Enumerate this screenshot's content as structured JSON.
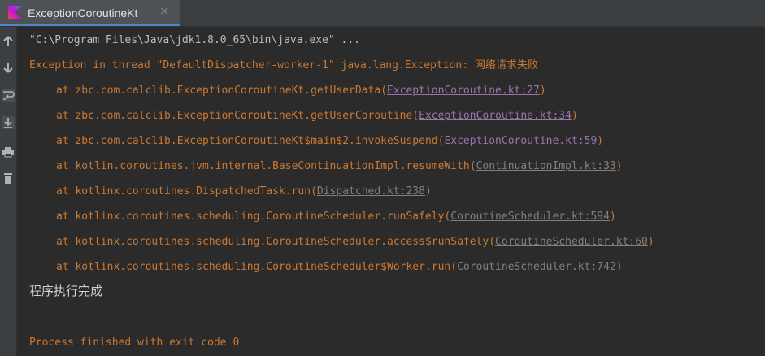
{
  "tab": {
    "title": "ExceptionCoroutineKt",
    "close_glyph": "×",
    "icon": "kotlin-icon"
  },
  "sidebar": {
    "icons": [
      "arrow-up-icon",
      "arrow-down-icon",
      "soft-wrap-icon",
      "scroll-to-end-icon",
      "print-icon",
      "trash-icon"
    ]
  },
  "console": {
    "command": "\"C:\\Program Files\\Java\\jdk1.8.0_65\\bin\\java.exe\" ...",
    "exception_prefix": "Exception in thread \"DefaultDispatcher-worker-1\" java.lang.Exception: ",
    "exception_message": "网络请求失败",
    "trace": [
      {
        "text": "at zbc.com.calclib.ExceptionCoroutineKt.getUserData(",
        "link": "ExceptionCoroutine.kt:27",
        "visited": true
      },
      {
        "text": "at zbc.com.calclib.ExceptionCoroutineKt.getUserCoroutine(",
        "link": "ExceptionCoroutine.kt:34",
        "visited": true
      },
      {
        "text": "at zbc.com.calclib.ExceptionCoroutineKt$main$2.invokeSuspend(",
        "link": "ExceptionCoroutine.kt:59",
        "visited": true
      },
      {
        "text": "at kotlin.coroutines.jvm.internal.BaseContinuationImpl.resumeWith(",
        "link": "ContinuationImpl.kt:33",
        "visited": false
      },
      {
        "text": "at kotlinx.coroutines.DispatchedTask.run(",
        "link": "Dispatched.kt:238",
        "visited": false
      },
      {
        "text": "at kotlinx.coroutines.scheduling.CoroutineScheduler.runSafely(",
        "link": "CoroutineScheduler.kt:594",
        "visited": false
      },
      {
        "text": "at kotlinx.coroutines.scheduling.CoroutineScheduler.access$runSafely(",
        "link": "CoroutineScheduler.kt:60",
        "visited": false
      },
      {
        "text": "at kotlinx.coroutines.scheduling.CoroutineScheduler$Worker.run(",
        "link": "CoroutineScheduler.kt:742",
        "visited": false
      }
    ],
    "done_message": "程序执行完成",
    "exit_message": "Process finished with exit code 0"
  },
  "colors": {
    "background": "#2b2b2b",
    "error": "#cc7832",
    "link_visited": "#9876aa",
    "link": "#808080",
    "tab_underline": "#4a88c7"
  }
}
